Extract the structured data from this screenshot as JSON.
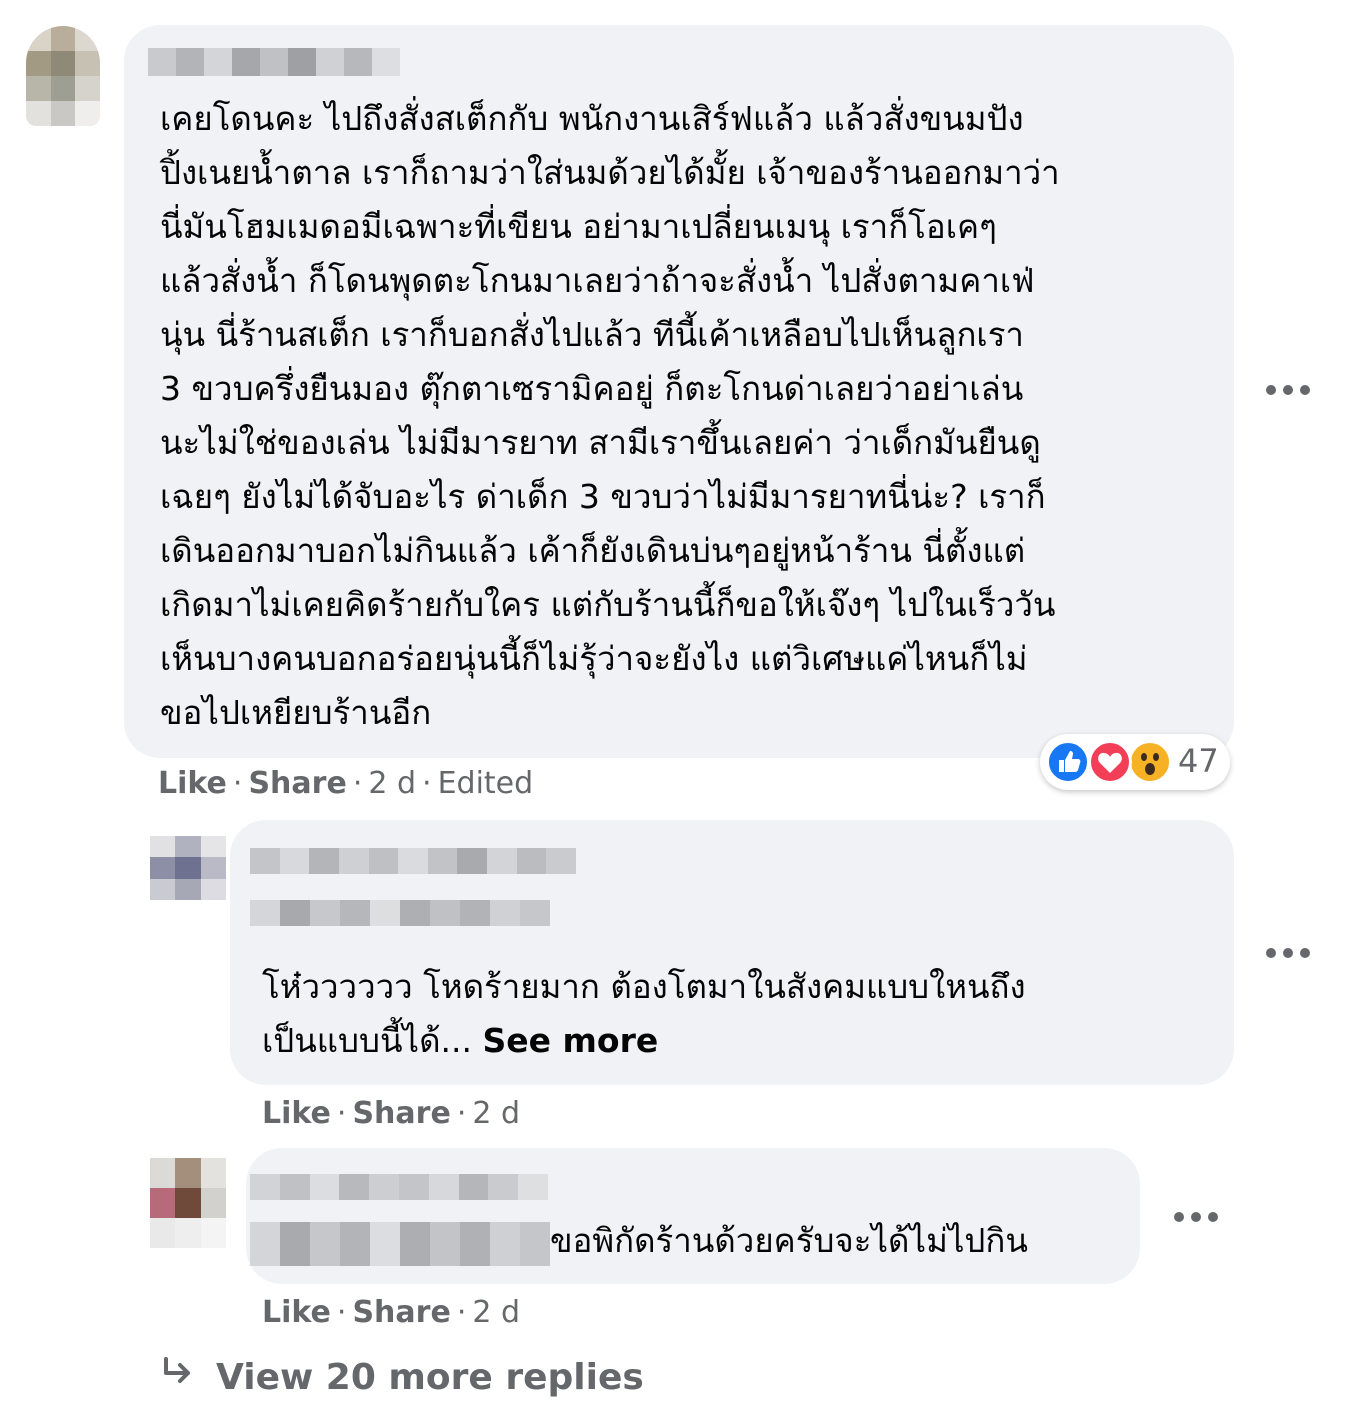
{
  "comments": [
    {
      "text_lines": [
        "เคยโดนคะ ไปถึงสั่งสเต็กกับ พนักงานเสิร์ฟแล้ว แล้วสั่งขนมปัง",
        "ปิ้งเนยน้ำตาล เราก็ถามว่าใส่นมด้วยได้มั้ย เจ้าของร้านออกมาว่า",
        "นี่มันโฮมเมดอมีเฉพาะที่เขียน อย่ามาเปลี่ยนเมนุ เราก็โอเคๆ",
        "แล้วสั่งน้ำ ก็โดนพุดตะโกนมาเลยว่าถ้าจะสั่งน้ำ ไปสั่งตามคาเฟ่",
        "นุ่น นี่ร้านสเต็ก เราก็บอกสั่งไปแล้ว ทีนี้เค้าเหลือบไปเห็นลูกเรา",
        "3 ขวบครึ่งยืนมอง ตุ๊กตาเซรามิคอยู่ ก็ตะโกนด่าเลยว่าอย่าเล่น",
        "นะไม่ใช่ของเล่น ไม่มีมารยาท สามีเราขึ้นเลยค่า ว่าเด็กมันยืนดู",
        "เฉยๆ ยังไม่ได้จับอะไร ด่าเด็ก 3 ขวบว่าไม่มีมารยาทนี่น่ะ? เราก็",
        "เดินออกมาบอกไม่กินแล้ว เค้าก็ยังเดินบ่นๆอยู่หน้าร้าน นี่ตั้งแต่",
        "เกิดมาไม่เคยคิดร้ายกับใคร แต่กับร้านนี้ก็ขอให้เจ๊งๆ ไปในเร็ววัน",
        "เห็นบางคนบอกอร่อยนุ่นนี้ก็ไม่รุ้ว่าจะยังไง แต่วิเศษแค่ไหนก็ไม่",
        "ขอไปเหยียบร้านอีก"
      ],
      "like_label": "Like",
      "share_label": "Share",
      "time": "2 d",
      "edited_label": "Edited",
      "reaction_count": "47",
      "reaction_icons": [
        "like-reaction",
        "love-reaction",
        "wow-reaction"
      ]
    },
    {
      "text_lines": [
        "โห๋วววววว โหดร้ายมาก ต้องโตมาในสังคมแบบใหนถึง"
      ],
      "last_line": "เป็นแบบนี้ได้...",
      "see_more": "See more",
      "like_label": "Like",
      "share_label": "Share",
      "time": "2 d"
    },
    {
      "text": "ขอพิกัดร้านด้วยครับจะได้ไม่ไปกิน",
      "like_label": "Like",
      "share_label": "Share",
      "time": "2 d"
    }
  ],
  "view_more": "View 20 more replies",
  "colors": {
    "bubble": "#f0f2f5",
    "meta_text": "#65676b",
    "like_blue": "#1877f2",
    "love_red": "#f33e58",
    "wow_yellow": "#f7b125"
  }
}
